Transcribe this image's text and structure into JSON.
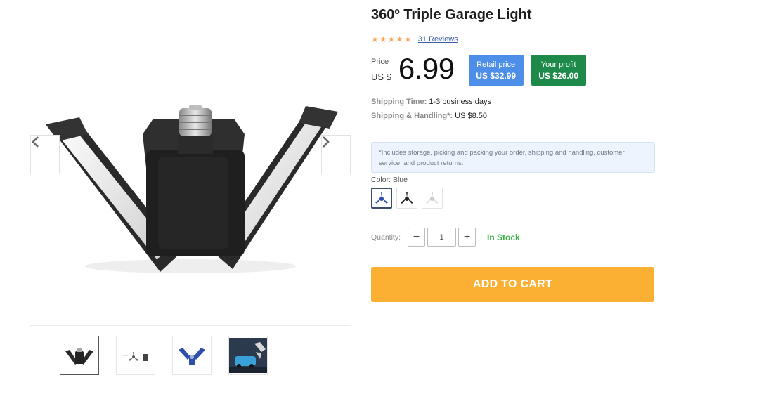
{
  "product": {
    "title": "360º Triple Garage Light",
    "rating_stars": "★★★★★",
    "reviews": "31 Reviews",
    "price_label": "Price",
    "currency": "US $",
    "price": "6.99",
    "retail_label": "Retail price",
    "retail_value": "US $32.99",
    "profit_label": "Your profit",
    "profit_value": "US $26.00",
    "shipping_time_label": "Shipping Time:",
    "shipping_time_value": "1-3 business days",
    "shipping_handling_label": "Shipping & Handling*:",
    "shipping_handling_value": "US $8.50",
    "note": "*Includes storage, picking and packing your order, shipping and handling, customer service, and product returns.",
    "color_label": "Color:",
    "color_value": "Blue",
    "quantity_label": "Quantity:",
    "quantity_value": "1",
    "minus": "−",
    "plus": "+",
    "stock": "In Stock",
    "cart_button": "ADD TO CART"
  },
  "gallery": {
    "prev_icon": "chevron-left-icon",
    "next_icon": "chevron-right-icon"
  },
  "colors": {
    "accent_orange": "#fbb034",
    "retail_blue": "#4d8ee8",
    "profit_green": "#1d8a49",
    "stock_green": "#3bb14a",
    "star": "#f5a65b"
  }
}
